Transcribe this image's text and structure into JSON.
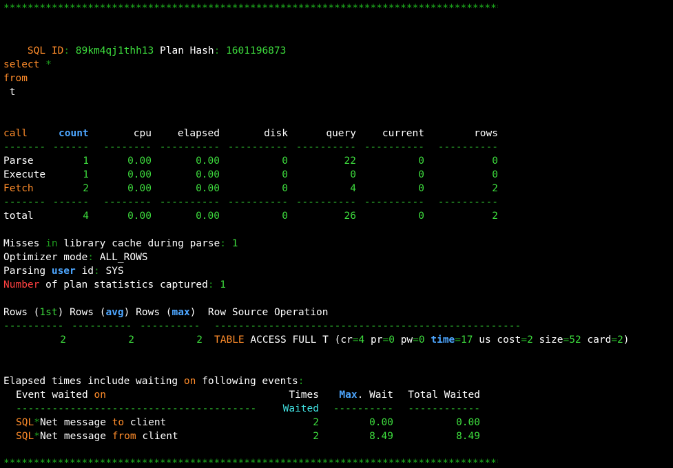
{
  "border": "**************************************************************************************",
  "header": {
    "sql_id_label": "SQL ID",
    "colon": ":",
    "sql_id": "89km4qj1thh13",
    "plan_hash_label": "Plan Hash",
    "plan_hash": "1601196873"
  },
  "sql": {
    "select_kw": "select",
    "star": "*",
    "from_kw": "from",
    "table": "t"
  },
  "stats": {
    "headers": [
      "call",
      "count",
      "cpu",
      "elapsed",
      "disk",
      "query",
      "current",
      "rows"
    ],
    "sep": [
      "-------",
      "------",
      "--------",
      "----------",
      "----------",
      "----------",
      "----------",
      "----------"
    ],
    "rows": [
      {
        "call": "Parse",
        "count": "1",
        "cpu": "0.00",
        "elapsed": "0.00",
        "disk": "0",
        "query": "22",
        "current": "0",
        "rows": "0"
      },
      {
        "call": "Execute",
        "count": "1",
        "cpu": "0.00",
        "elapsed": "0.00",
        "disk": "0",
        "query": "0",
        "current": "0",
        "rows": "0"
      },
      {
        "call": "Fetch",
        "count": "2",
        "cpu": "0.00",
        "elapsed": "0.00",
        "disk": "0",
        "query": "4",
        "current": "0",
        "rows": "2"
      }
    ],
    "total": {
      "call": "total",
      "count": "4",
      "cpu": "0.00",
      "elapsed": "0.00",
      "disk": "0",
      "query": "26",
      "current": "0",
      "rows": "2"
    }
  },
  "info": {
    "misses_a": "Misses ",
    "misses_in": "in",
    "misses_b": " library cache during parse",
    "misses_val": "1",
    "opt_label": "Optimizer mode",
    "opt_val": "ALL_ROWS",
    "parsing_a": "Parsing ",
    "parsing_user": "user",
    "parsing_b": " id",
    "parsing_val": "SYS",
    "number_kw": "Number",
    "number_b": " of plan statistics captured",
    "number_val": "1"
  },
  "plan": {
    "rows_label": "Rows",
    "first": "1st",
    "avg": "avg",
    "max": "max",
    "rso_label": "Row Source Operation",
    "sep_rows": "----------",
    "sep_op": "---------------------------------------------------",
    "row": {
      "r1": "2",
      "r2": "2",
      "r3": "2",
      "table_kw": "TABLE",
      "op_a": " ACCESS FULL T (",
      "cr_k": "cr",
      "cr_v": "4",
      "pr_k": "pr",
      "pr_v": "0",
      "pw_k": "pw",
      "pw_v": "0",
      "time_k": "time",
      "time_v": "17",
      "us_cost": " us cost",
      "cost_v": "2",
      "size_k": " size",
      "size_v": "52",
      "card_k": " card",
      "card_v": "2",
      "close": ")"
    }
  },
  "waits": {
    "intro_a": "Elapsed times include waiting ",
    "intro_on": "on",
    "intro_b": " following events",
    "ev_label": "Event waited ",
    "ev_on": "on",
    "times": "Times",
    "waited": "Waited",
    "max_kw": "Max",
    "max_rest": ". Wait",
    "total_waited": "Total Waited",
    "sep_event": "----------------------------------------",
    "sep_times": "----------",
    "sep_max": "----------",
    "sep_total": "------------",
    "events": [
      {
        "sql": "SQL",
        "star": "*",
        "mid": "Net message ",
        "kw": "to",
        "tail": " client",
        "times": "2",
        "max": "0.00",
        "total": "0.00"
      },
      {
        "sql": "SQL",
        "star": "*",
        "mid": "Net message ",
        "kw": "from",
        "tail": " client",
        "times": "2",
        "max": "8.49",
        "total": "8.49"
      }
    ]
  }
}
